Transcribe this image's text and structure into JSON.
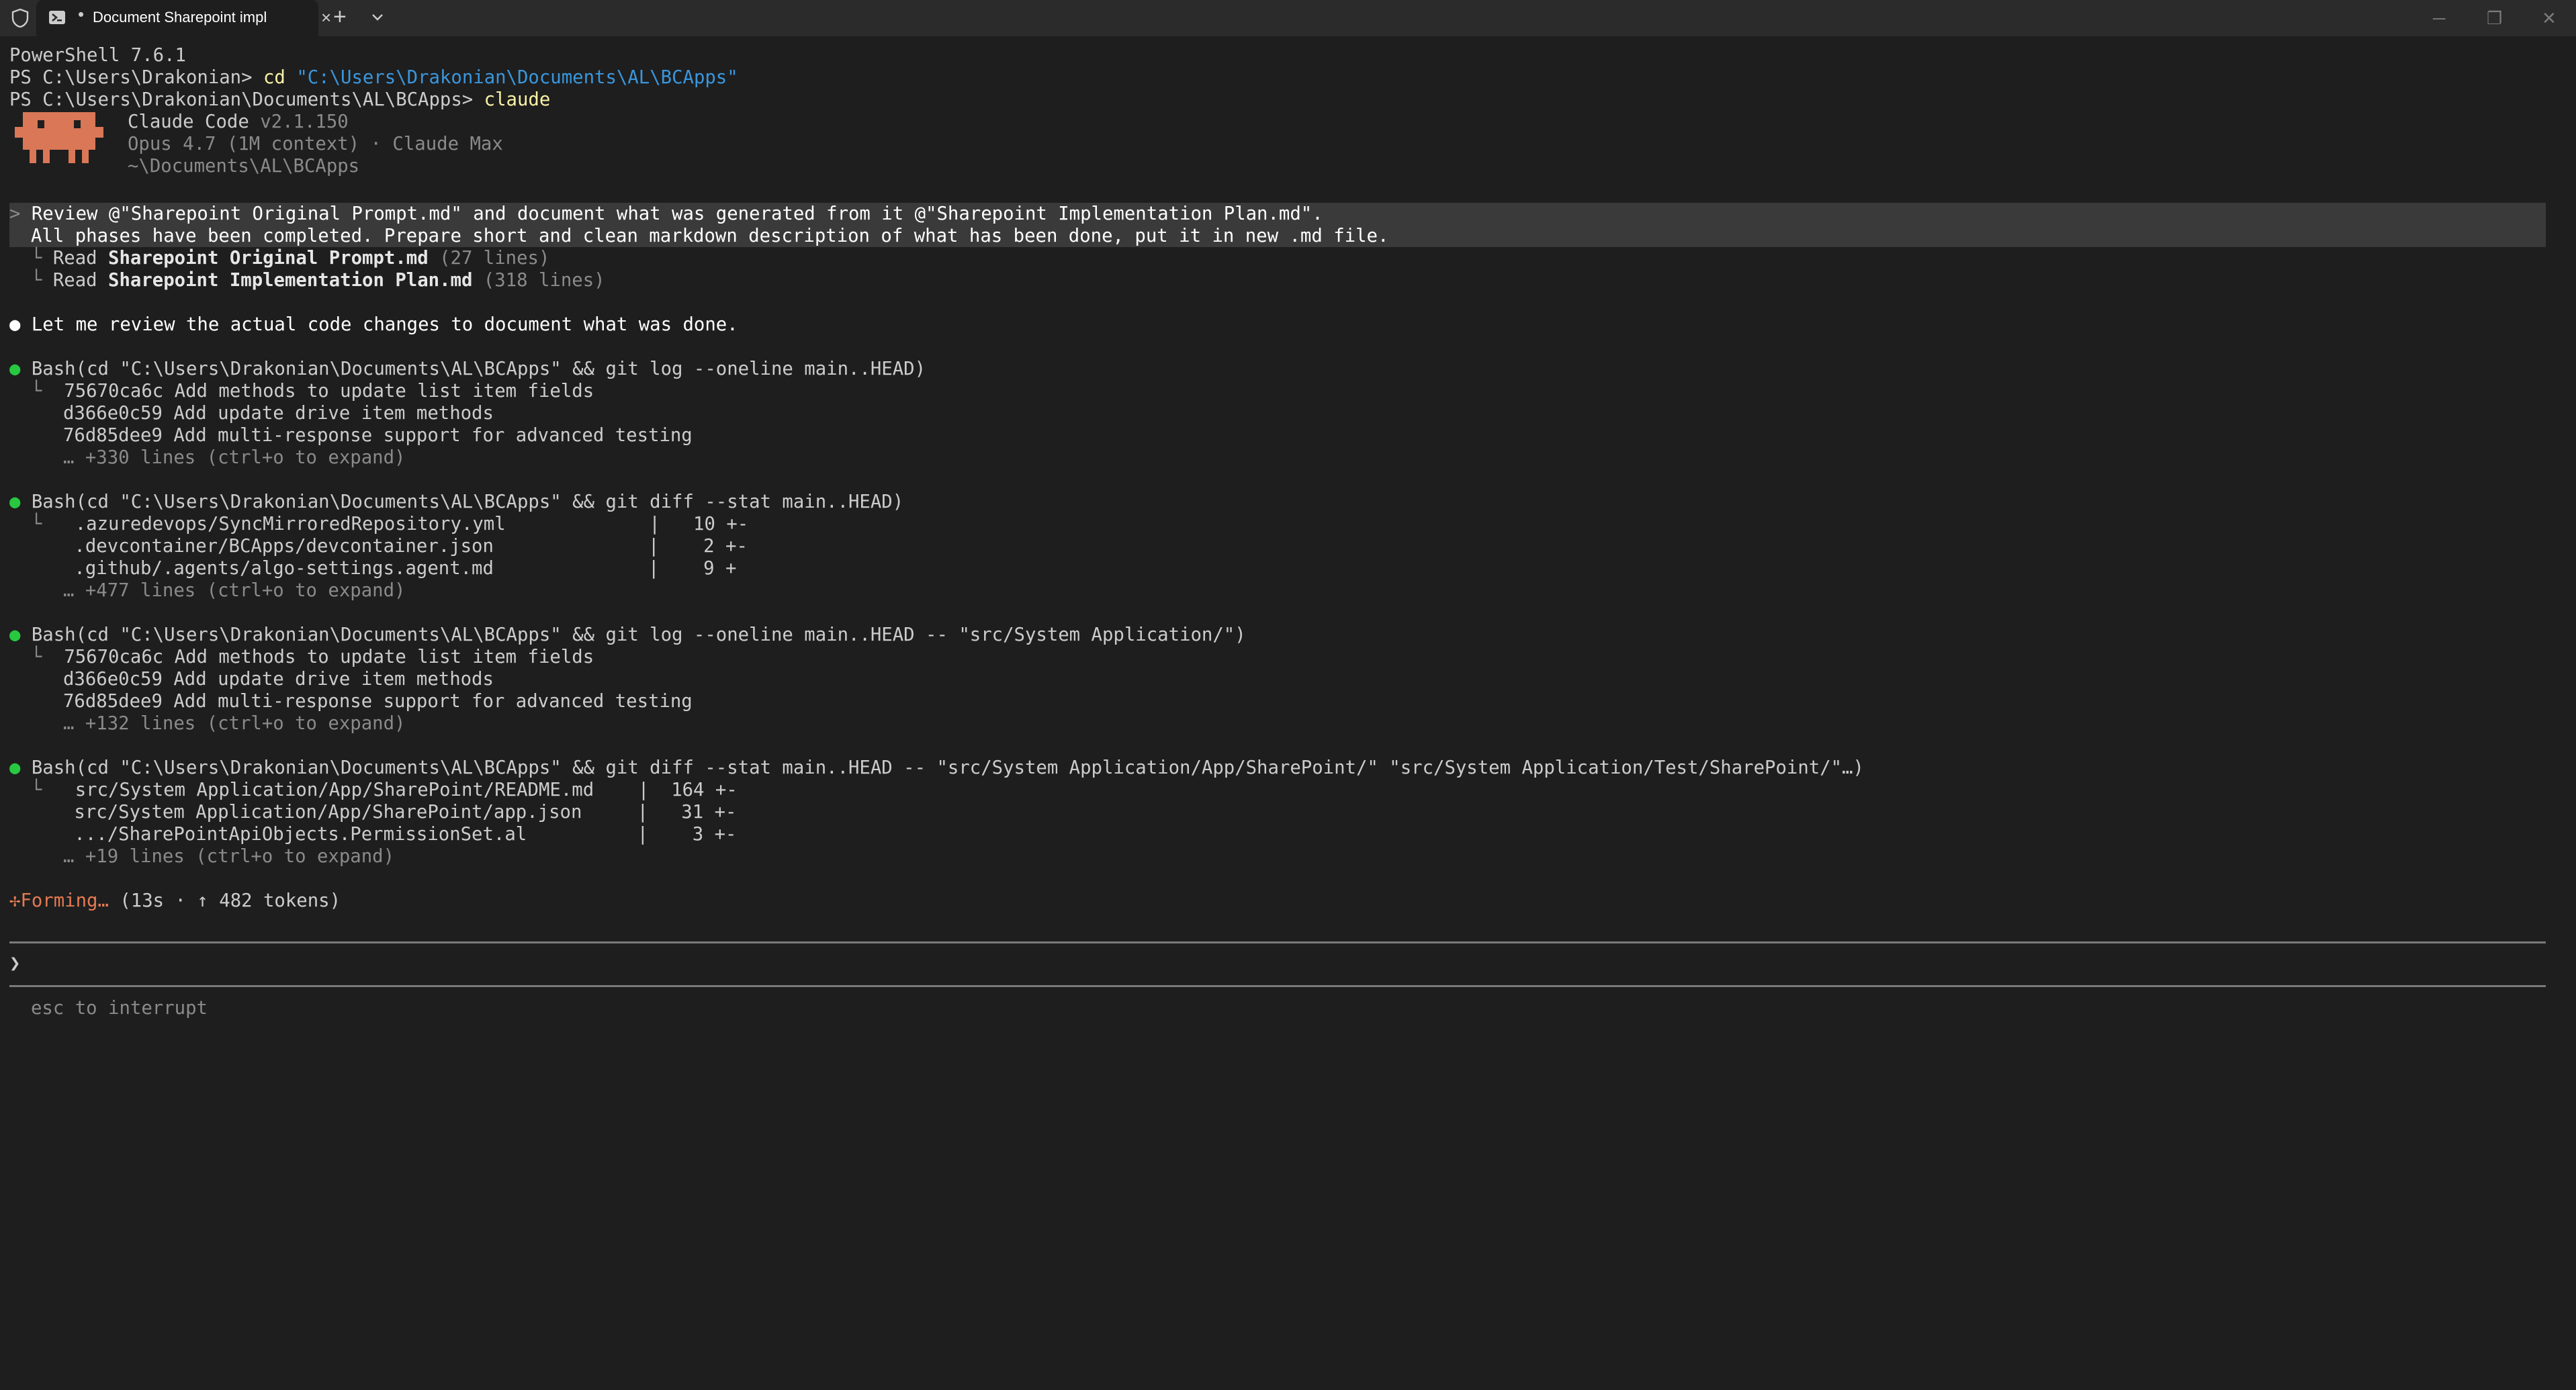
{
  "window": {
    "tab_title": "Document Sharepoint impl",
    "tab_indicator": "•",
    "close_glyph": "×",
    "new_tab_glyph": "+",
    "minimize_glyph": "─",
    "restore_glyph": "❐",
    "window_close_glyph": "✕"
  },
  "terminal": {
    "ps_version": "PowerShell 7.6.1",
    "prompt1": "PS C:\\Users\\Drakonian> ",
    "cmd1": "cd ",
    "cmd1_arg": "\"C:\\Users\\Drakonian\\Documents\\AL\\BCApps\"",
    "prompt2": "PS C:\\Users\\Drakonian\\Documents\\AL\\BCApps> ",
    "cmd2": "claude",
    "claude_name": "Claude Code ",
    "claude_version": "v2.1.150",
    "model_info": "Opus 4.7 (1M context) · Claude Max",
    "cwd": "~\\Documents\\AL\\BCApps",
    "user_chevron": ">",
    "user_msg1": "Review @\"Sharepoint Original Prompt.md\" and document what was generated from it @\"Sharepoint Implementation Plan.md\".",
    "user_msg2": "All phases have been completed. Prepare short and clean markdown description of what has been done, put it in new .md file.",
    "tree": "└",
    "read_label": "Read ",
    "read1_file": "Sharepoint Original Prompt.md",
    "read1_lines": " (27 lines)",
    "read2_file": "Sharepoint Implementation Plan.md",
    "read2_lines": " (318 lines)",
    "bullet": "●",
    "assistant_msg": "Let me review the actual code changes to document what was done.",
    "bash1": "Bash(cd \"C:\\Users\\Drakonian\\Documents\\AL\\BCApps\" && git log --oneline main..HEAD)",
    "bash1_out": [
      "75670ca6c Add methods to update list item fields",
      "d366e0c59 Add update drive item methods",
      "76d85dee9 Add multi-response support for advanced testing"
    ],
    "bash1_more": "… +330 lines (ctrl+o to expand)",
    "bash2": "Bash(cd \"C:\\Users\\Drakonian\\Documents\\AL\\BCApps\" && git diff --stat main..HEAD)",
    "bash2_out": [
      " .azuredevops/SyncMirroredRepository.yml             |   10 +-",
      " .devcontainer/BCApps/devcontainer.json              |    2 +-",
      " .github/.agents/algo-settings.agent.md              |    9 +"
    ],
    "bash2_more": "… +477 lines (ctrl+o to expand)",
    "bash3": "Bash(cd \"C:\\Users\\Drakonian\\Documents\\AL\\BCApps\" && git log --oneline main..HEAD -- \"src/System Application/\")",
    "bash3_out": [
      "75670ca6c Add methods to update list item fields",
      "d366e0c59 Add update drive item methods",
      "76d85dee9 Add multi-response support for advanced testing"
    ],
    "bash3_more": "… +132 lines (ctrl+o to expand)",
    "bash4": "Bash(cd \"C:\\Users\\Drakonian\\Documents\\AL\\BCApps\" && git diff --stat main..HEAD -- \"src/System Application/App/SharePoint/\" \"src/System Application/Test/SharePoint/\"…)",
    "bash4_out": [
      " src/System Application/App/SharePoint/README.md    |  164 +-",
      " src/System Application/App/SharePoint/app.json     |   31 +-",
      " .../SharePointApiObjects.PermissionSet.al          |    3 +-"
    ],
    "bash4_more": "… +19 lines (ctrl+o to expand)",
    "spinner": "✢",
    "status_word": "Forming…",
    "status_detail": " (13s · ↑ 482 tokens)",
    "input_chevron": "❯",
    "hint": "esc to interrupt"
  },
  "colors": {
    "background": "#1e1e1e",
    "accent_orange": "#e57a52",
    "success_green": "#28c840",
    "path_blue": "#3a96dd",
    "command_yellow": "#f9f1a5"
  }
}
